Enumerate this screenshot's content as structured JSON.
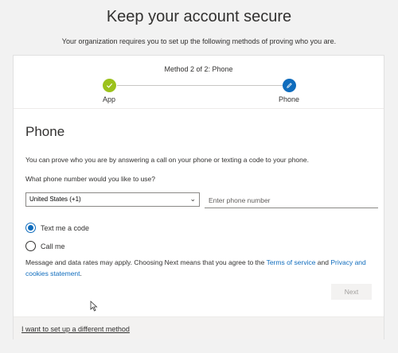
{
  "header": {
    "title": "Keep your account secure",
    "subtitle": "Your organization requires you to set up the following methods of proving who you are."
  },
  "progress": {
    "method_label": "Method 2 of 2: Phone",
    "steps": [
      {
        "label": "App",
        "state": "complete",
        "icon": "checkmark-icon",
        "color": "#9cc21c"
      },
      {
        "label": "Phone",
        "state": "current",
        "icon": "pencil-icon",
        "color": "#0f6cbd"
      }
    ]
  },
  "form": {
    "section_title": "Phone",
    "description": "You can prove who you are by answering a call on your phone or texting a code to your phone.",
    "question": "What phone number would you like to use?",
    "country_value": "United States (+1)",
    "phone_placeholder": "Enter phone number",
    "options": [
      {
        "label": "Text me a code",
        "selected": true
      },
      {
        "label": "Call me",
        "selected": false
      }
    ],
    "legal": {
      "prefix": "Message and data rates may apply. Choosing Next means that you agree to the ",
      "terms_link": "Terms of service",
      "and": " and ",
      "privacy_link": "Privacy and cookies statement",
      "suffix": "."
    },
    "next_label": "Next"
  },
  "footer": {
    "link": "I want to set up a different method"
  },
  "colors": {
    "accent": "#0f6cbd",
    "success": "#9cc21c"
  }
}
